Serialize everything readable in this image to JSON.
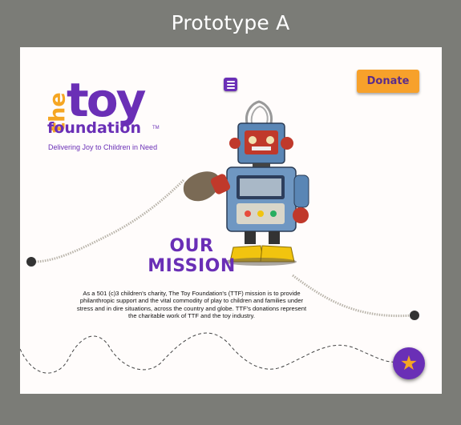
{
  "frame": {
    "title": "Prototype A"
  },
  "header": {
    "logo": {
      "the": "the",
      "toy": "toy",
      "foundation": "foundation",
      "tm": "TM"
    },
    "tagline": "Delivering Joy to Children in Need",
    "menu_icon": "hamburger-menu-icon",
    "donate_label": "Donate"
  },
  "mission": {
    "title_line1": "OUR",
    "title_line2": "MISSION",
    "body": "As a 501 (c)3 children's charity, The Toy Foundation's (TTF) mission is to provide philanthropic support and the vital commodity of play to children and families under stress and in dire situations, across the country and globe. TTF's donations represent the charitable work of TTF and the toy industry."
  },
  "fab": {
    "icon": "star-icon",
    "glyph": "★"
  },
  "colors": {
    "brand_purple": "#6a2fb6",
    "brand_orange": "#f5a623",
    "frame_gray": "#7b7c77"
  }
}
